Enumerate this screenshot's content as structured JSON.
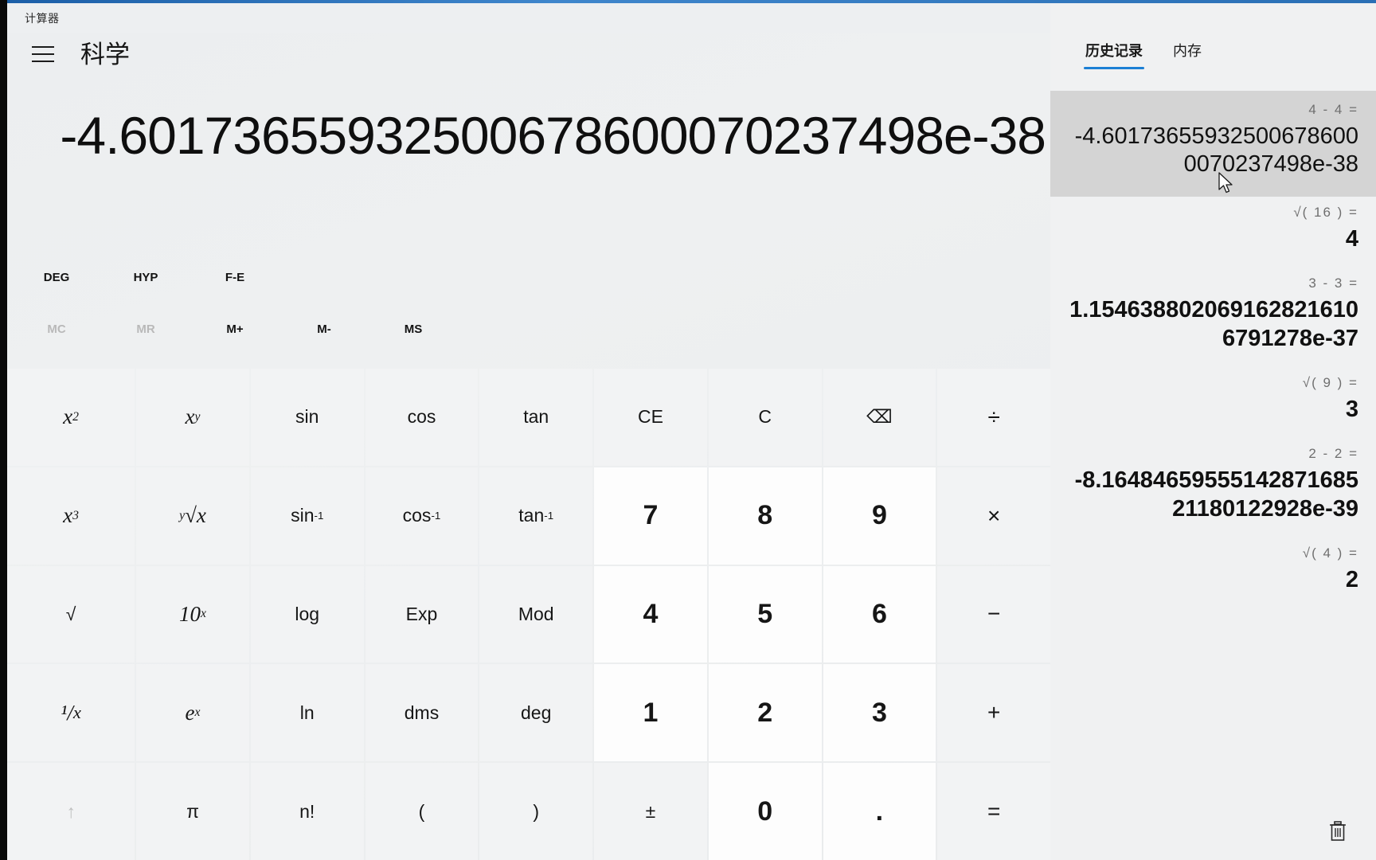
{
  "window": {
    "app_title": "计算器",
    "controls": [
      {
        "name": "minimize",
        "glyph": "–"
      },
      {
        "name": "maximize",
        "glyph": "□"
      },
      {
        "name": "close",
        "glyph": "✕"
      }
    ]
  },
  "header": {
    "menu_icon": "hamburger-icon",
    "mode_title": "科学"
  },
  "display": {
    "value": "-4.60173655932500678600070237498e-38"
  },
  "toggles": {
    "row1": [
      {
        "label": "DEG",
        "disabled": false
      },
      {
        "label": "HYP",
        "disabled": false
      },
      {
        "label": "F-E",
        "disabled": false
      }
    ],
    "row2": [
      {
        "label": "MC",
        "disabled": true
      },
      {
        "label": "MR",
        "disabled": true
      },
      {
        "label": "M+",
        "disabled": false
      },
      {
        "label": "M-",
        "disabled": false
      },
      {
        "label": "MS",
        "disabled": false
      }
    ]
  },
  "keypad": {
    "rows": [
      [
        {
          "label": "x2",
          "html": "x<sup>2</sup>",
          "kind": "fn-italic"
        },
        {
          "label": "xy",
          "html": "x<sup>y</sup>",
          "kind": "fn-italic"
        },
        {
          "label": "sin",
          "html": "sin",
          "kind": "fn"
        },
        {
          "label": "cos",
          "html": "cos",
          "kind": "fn"
        },
        {
          "label": "tan",
          "html": "tan",
          "kind": "fn"
        },
        {
          "label": "CE",
          "html": "CE",
          "kind": "fn"
        },
        {
          "label": "C",
          "html": "C",
          "kind": "fn"
        },
        {
          "label": "backspace",
          "html": "&#9003;",
          "kind": "fn"
        },
        {
          "label": "divide",
          "html": "&divide;",
          "kind": "op"
        }
      ],
      [
        {
          "label": "x3",
          "html": "x<sup>3</sup>",
          "kind": "fn-italic"
        },
        {
          "label": "yroot",
          "html": "<sup>y</sup>&radic;x",
          "kind": "fn-italic"
        },
        {
          "label": "sin-1",
          "html": "sin<sup>-1</sup>",
          "kind": "fn"
        },
        {
          "label": "cos-1",
          "html": "cos<sup>-1</sup>",
          "kind": "fn"
        },
        {
          "label": "tan-1",
          "html": "tan<sup>-1</sup>",
          "kind": "fn"
        },
        {
          "label": "7",
          "html": "7",
          "kind": "num"
        },
        {
          "label": "8",
          "html": "8",
          "kind": "num"
        },
        {
          "label": "9",
          "html": "9",
          "kind": "num"
        },
        {
          "label": "multiply",
          "html": "&times;",
          "kind": "op"
        }
      ],
      [
        {
          "label": "sqrt",
          "html": "&radic;",
          "kind": "fn"
        },
        {
          "label": "10x",
          "html": "10<sup>x</sup>",
          "kind": "fn-italic"
        },
        {
          "label": "log",
          "html": "log",
          "kind": "fn"
        },
        {
          "label": "Exp",
          "html": "Exp",
          "kind": "fn"
        },
        {
          "label": "Mod",
          "html": "Mod",
          "kind": "fn"
        },
        {
          "label": "4",
          "html": "4",
          "kind": "num"
        },
        {
          "label": "5",
          "html": "5",
          "kind": "num"
        },
        {
          "label": "6",
          "html": "6",
          "kind": "num"
        },
        {
          "label": "minus",
          "html": "&minus;",
          "kind": "op"
        }
      ],
      [
        {
          "label": "1/x",
          "html": "&#185;/<sub>x</sub>",
          "kind": "fn-italic"
        },
        {
          "label": "ex",
          "html": "e<sup>x</sup>",
          "kind": "fn-italic"
        },
        {
          "label": "ln",
          "html": "ln",
          "kind": "fn"
        },
        {
          "label": "dms",
          "html": "dms",
          "kind": "fn"
        },
        {
          "label": "deg",
          "html": "deg",
          "kind": "fn"
        },
        {
          "label": "1",
          "html": "1",
          "kind": "num"
        },
        {
          "label": "2",
          "html": "2",
          "kind": "num"
        },
        {
          "label": "3",
          "html": "3",
          "kind": "num"
        },
        {
          "label": "plus",
          "html": "+",
          "kind": "op"
        }
      ],
      [
        {
          "label": "up",
          "html": "&uarr;",
          "kind": "dim"
        },
        {
          "label": "pi",
          "html": "&pi;",
          "kind": "fn"
        },
        {
          "label": "n!",
          "html": "n!",
          "kind": "fn"
        },
        {
          "label": "open-paren",
          "html": "(",
          "kind": "fn"
        },
        {
          "label": "close-paren",
          "html": ")",
          "kind": "fn"
        },
        {
          "label": "plusminus",
          "html": "&plusmn;",
          "kind": "fn"
        },
        {
          "label": "0",
          "html": "0",
          "kind": "num"
        },
        {
          "label": "decimal",
          "html": ".",
          "kind": "num"
        },
        {
          "label": "equals",
          "html": "=",
          "kind": "op"
        }
      ]
    ]
  },
  "history": {
    "tabs": [
      {
        "label": "历史记录",
        "active": true
      },
      {
        "label": "内存",
        "active": false
      }
    ],
    "items": [
      {
        "expression": "4  -  4 =",
        "value": "-4.601736559325006786000070237498e-38",
        "selected": true
      },
      {
        "expression": "√( 16 ) =",
        "value": "4",
        "selected": false
      },
      {
        "expression": "3  -  3 =",
        "value": "1.1546388020691628216106791278e-37",
        "selected": false
      },
      {
        "expression": "√( 9 ) =",
        "value": "3",
        "selected": false
      },
      {
        "expression": "2  -  2 =",
        "value": "-8.16484659555142871685 21180122928e-39",
        "selected": false
      },
      {
        "expression": "√( 4 ) =",
        "value": "2",
        "selected": false
      }
    ],
    "clear_icon": "trash-icon"
  },
  "colors": {
    "accent": "#1b7fd4",
    "panel_bg": "#f0f1f2",
    "key_bg": "#f2f3f4",
    "num_key_bg": "#fdfdfd",
    "selected_bg": "#d4d4d4"
  }
}
